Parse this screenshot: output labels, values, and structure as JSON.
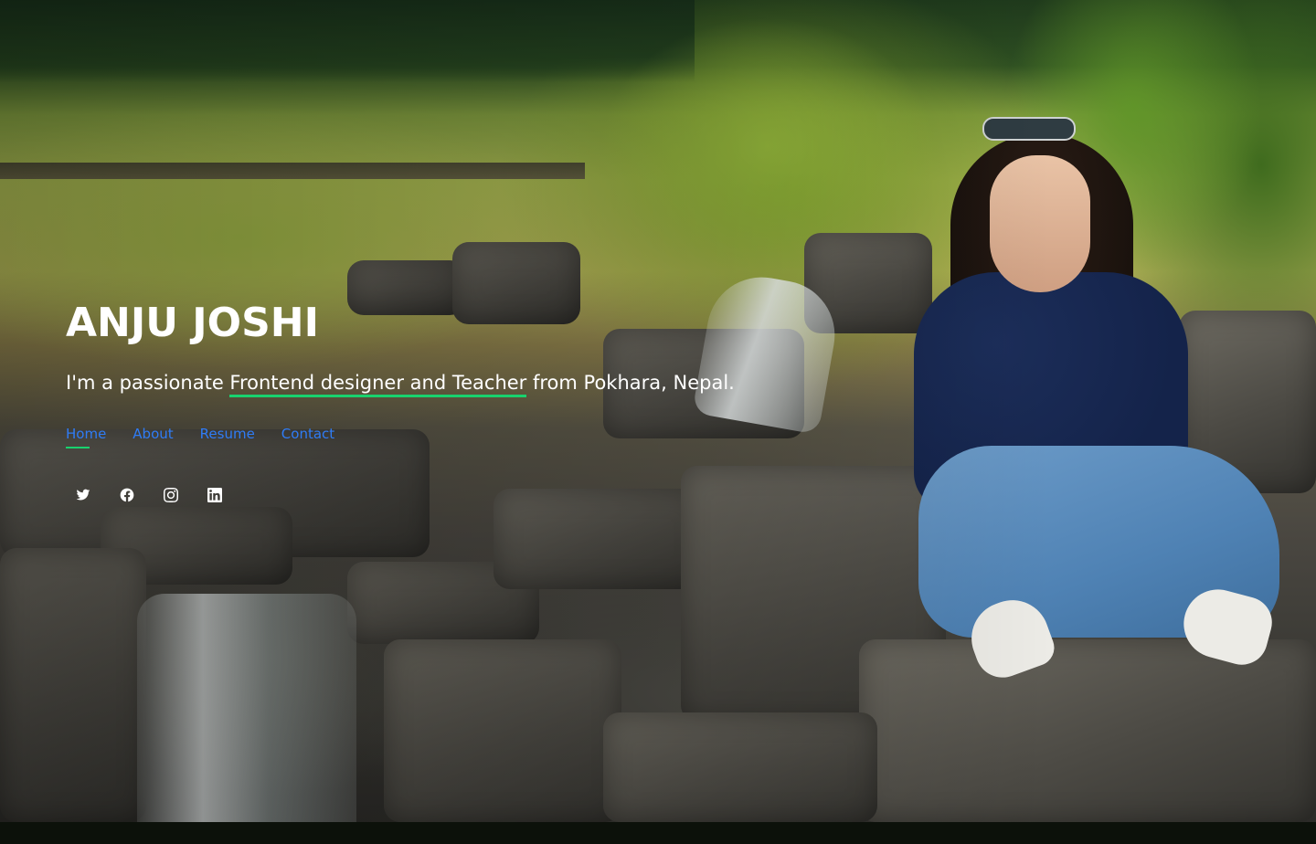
{
  "hero": {
    "name": "ANJU JOSHI",
    "tagline_prefix": "I'm a passionate ",
    "tagline_typed": "Frontend designer and Teacher",
    "tagline_suffix": " from Pokhara, Nepal.",
    "accent_color": "#18d26e",
    "link_color": "#2f7cf6"
  },
  "nav": {
    "items": [
      {
        "label": "Home",
        "active": true
      },
      {
        "label": "About",
        "active": false
      },
      {
        "label": "Resume",
        "active": false
      },
      {
        "label": "Contact",
        "active": false
      }
    ]
  },
  "social": {
    "icons": [
      "twitter-icon",
      "facebook-icon",
      "instagram-icon",
      "linkedin-icon"
    ]
  }
}
